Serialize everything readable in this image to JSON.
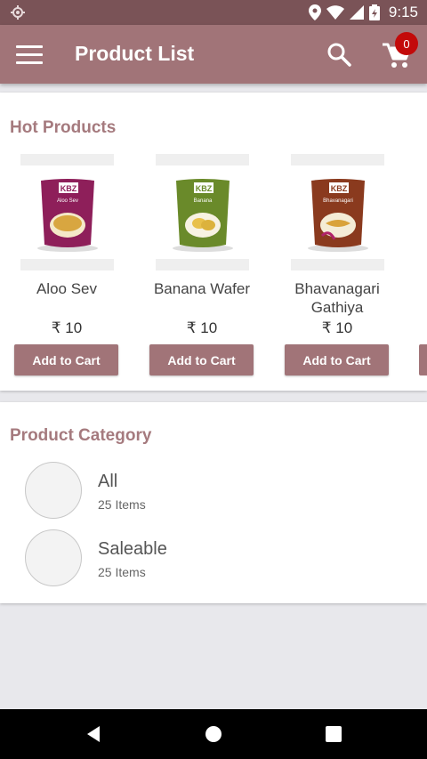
{
  "status_bar": {
    "time": "9:15"
  },
  "app_bar": {
    "title": "Product List",
    "cart_count": "0"
  },
  "hot_products": {
    "title": "Hot Products",
    "items": [
      {
        "name": "Aloo Sev",
        "price": "₹ 10",
        "button": "Add to Cart",
        "pack_color": "#8e1f5a",
        "pack_label": "Aloo Sev"
      },
      {
        "name": "Banana Wafer",
        "price": "₹ 10",
        "button": "Add to Cart",
        "pack_color": "#6a8a2a",
        "pack_label": "Banana"
      },
      {
        "name": "Bhavanagari Gathiya",
        "price": "₹ 10",
        "button": "Add to Cart",
        "pack_color": "#8a3a1e",
        "pack_label": "Bhavanagari"
      }
    ]
  },
  "categories": {
    "title": "Product Category",
    "items": [
      {
        "name": "All",
        "count": "25 Items"
      },
      {
        "name": "Saleable",
        "count": "25 Items"
      }
    ]
  },
  "brand": "KBZ"
}
